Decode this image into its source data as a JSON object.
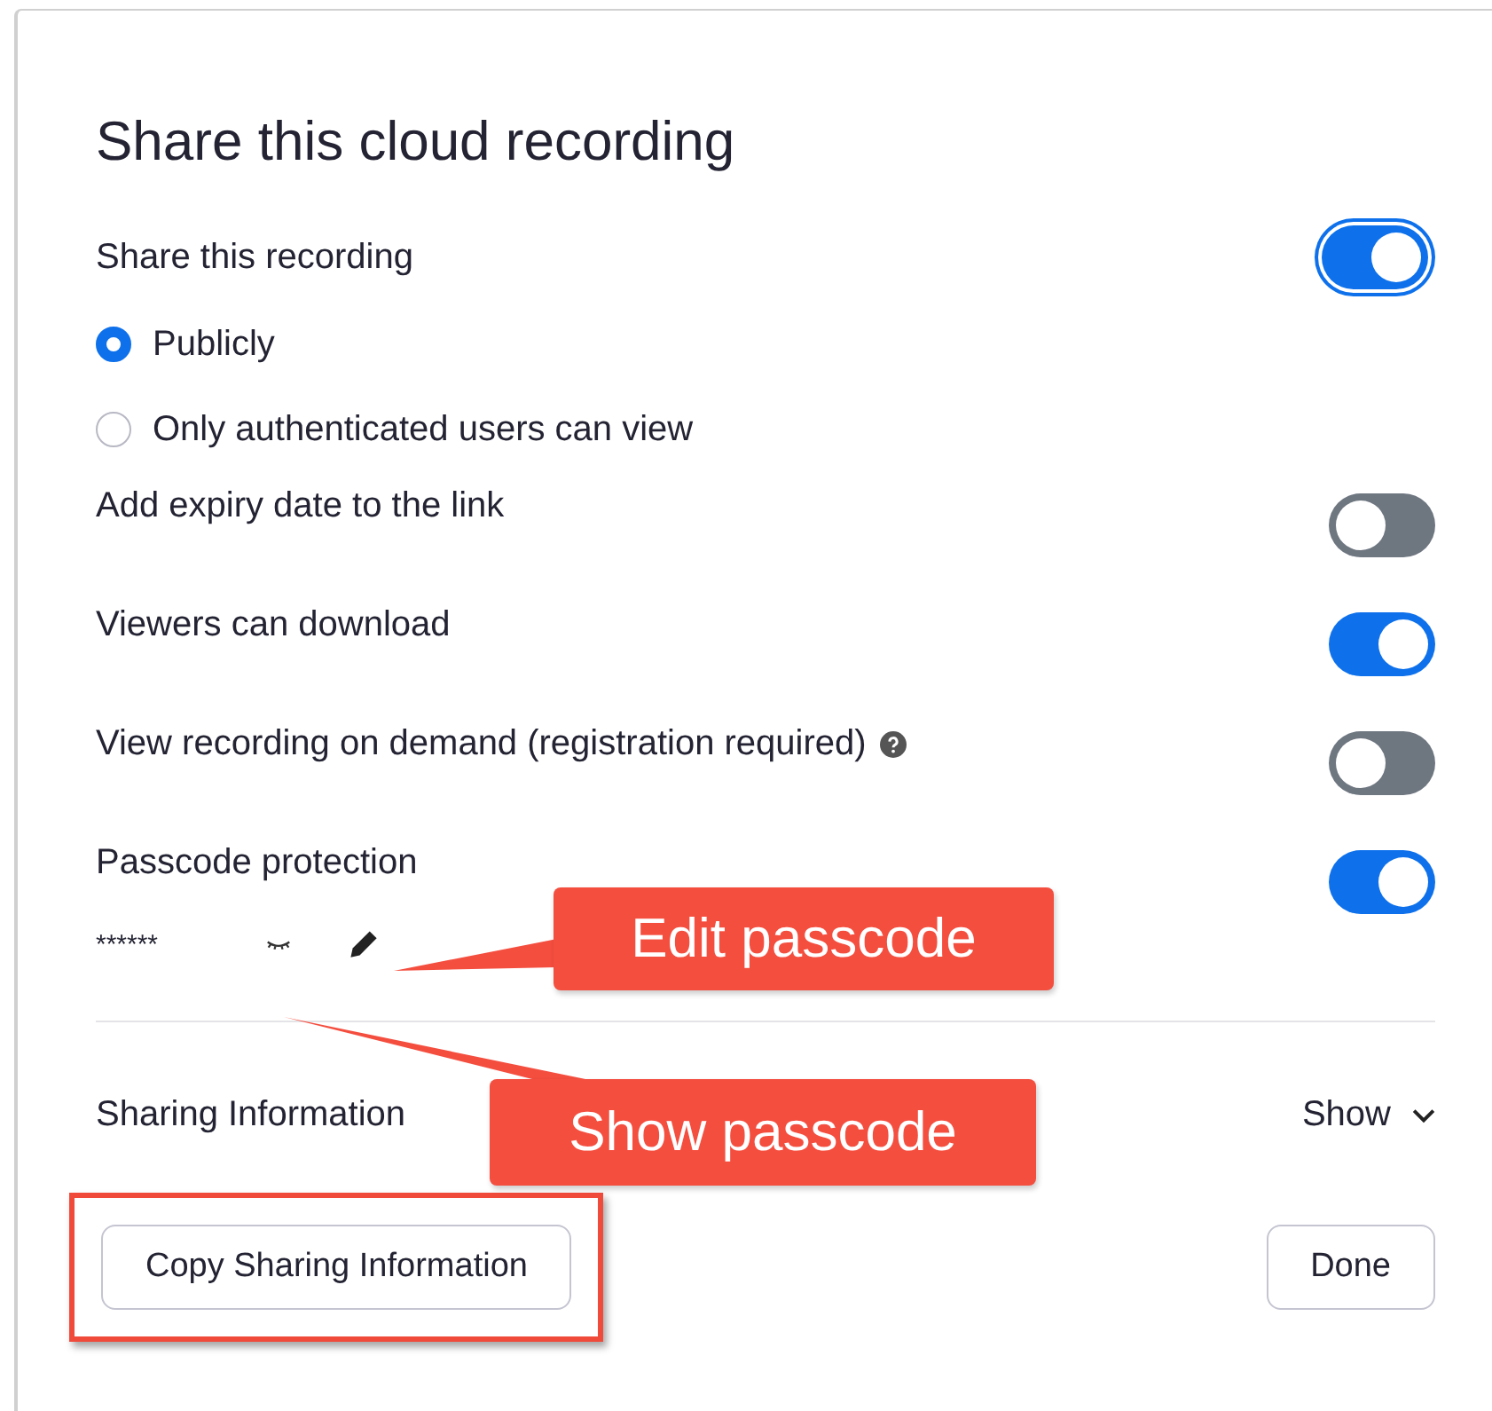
{
  "dialog": {
    "title": "Share this cloud recording",
    "share": {
      "label": "Share this recording",
      "on": true
    },
    "audience": [
      {
        "label": "Publicly",
        "selected": true
      },
      {
        "label": "Only authenticated users can view",
        "selected": false
      }
    ],
    "settings": [
      {
        "label": "Add expiry date to the link",
        "on": false,
        "help": false
      },
      {
        "label": "Viewers can download",
        "on": true,
        "help": false
      },
      {
        "label": "View recording on demand (registration required)",
        "on": false,
        "help": true
      },
      {
        "label": "Passcode protection",
        "on": true,
        "help": false
      }
    ],
    "passcode": {
      "value": "******"
    },
    "sharing_information": {
      "label": "Sharing Information",
      "toggle": "Show"
    },
    "buttons": [
      {
        "label": "Copy Sharing Information",
        "highlighted": true
      },
      {
        "label": "Done",
        "highlighted": false
      }
    ]
  },
  "callouts": [
    {
      "text": "Edit passcode"
    },
    {
      "text": "Show passcode"
    }
  ]
}
